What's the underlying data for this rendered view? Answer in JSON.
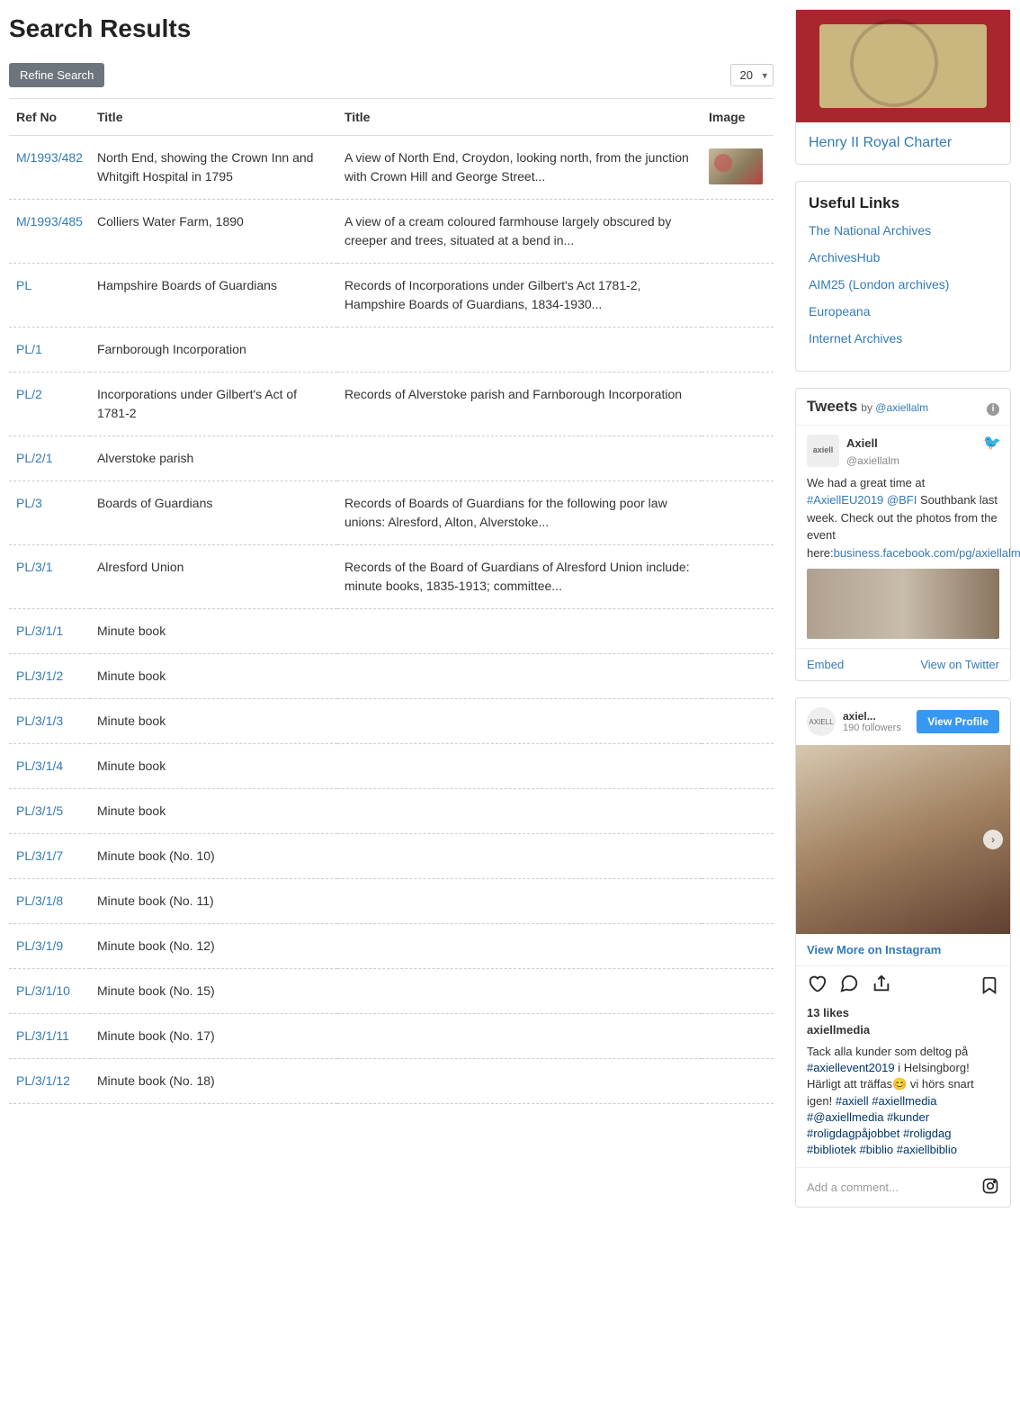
{
  "page_title": "Search Results",
  "refine_label": "Refine Search",
  "page_size": "20",
  "columns": [
    "Ref No",
    "Title",
    "Title",
    "Image"
  ],
  "rows": [
    {
      "ref": "M/1993/482",
      "t1": "North End, showing the Crown Inn and Whitgift Hospital in 1795",
      "t2": "A view of North End, Croydon, looking north, from the junction with Crown Hill and George Street...",
      "img": true
    },
    {
      "ref": "M/1993/485",
      "t1": "Colliers Water Farm, 1890",
      "t2": "A view of a cream coloured farmhouse largely obscured by creeper and trees, situated at a bend in...",
      "img": false
    },
    {
      "ref": "PL",
      "t1": "Hampshire Boards of Guardians",
      "t2": "Records of Incorporations under Gilbert's Act 1781-2, Hampshire Boards of Guardians, 1834-1930...",
      "img": false
    },
    {
      "ref": "PL/1",
      "t1": "Farnborough Incorporation",
      "t2": "",
      "img": false
    },
    {
      "ref": "PL/2",
      "t1": "Incorporations under Gilbert's Act of 1781-2",
      "t2": "Records of Alverstoke parish and Farnborough Incorporation",
      "img": false
    },
    {
      "ref": "PL/2/1",
      "t1": "Alverstoke parish",
      "t2": "",
      "img": false
    },
    {
      "ref": "PL/3",
      "t1": "Boards of Guardians",
      "t2": "Records of Boards of Guardians for the following poor law unions: Alresford, Alton, Alverstoke...",
      "img": false
    },
    {
      "ref": "PL/3/1",
      "t1": "Alresford Union",
      "t2": "Records of the Board of Guardians of Alresford Union include: minute books, 1835-1913; committee...",
      "img": false
    },
    {
      "ref": "PL/3/1/1",
      "t1": "Minute book",
      "t2": "",
      "img": false
    },
    {
      "ref": "PL/3/1/2",
      "t1": "Minute book",
      "t2": "",
      "img": false
    },
    {
      "ref": "PL/3/1/3",
      "t1": "Minute book",
      "t2": "",
      "img": false
    },
    {
      "ref": "PL/3/1/4",
      "t1": "Minute book",
      "t2": "",
      "img": false
    },
    {
      "ref": "PL/3/1/5",
      "t1": "Minute book",
      "t2": "",
      "img": false
    },
    {
      "ref": "PL/3/1/7",
      "t1": "Minute book (No. 10)",
      "t2": "",
      "img": false
    },
    {
      "ref": "PL/3/1/8",
      "t1": "Minute book (No. 11)",
      "t2": "",
      "img": false
    },
    {
      "ref": "PL/3/1/9",
      "t1": "Minute book (No. 12)",
      "t2": "",
      "img": false
    },
    {
      "ref": "PL/3/1/10",
      "t1": "Minute book (No. 15)",
      "t2": "",
      "img": false
    },
    {
      "ref": "PL/3/1/11",
      "t1": "Minute book (No. 17)",
      "t2": "",
      "img": false
    },
    {
      "ref": "PL/3/1/12",
      "t1": "Minute book (No. 18)",
      "t2": "",
      "img": false
    }
  ],
  "charter_link": "Henry II Royal Charter",
  "useful_links_title": "Useful Links",
  "useful_links": [
    "The National Archives",
    "ArchivesHub",
    "AIM25 (London archives)",
    "Europeana",
    "Internet Archives"
  ],
  "tweets": {
    "title": "Tweets",
    "by_prefix": "by ",
    "by_handle": "@axiellalm",
    "avatar": "axiell",
    "name": "Axiell",
    "handle": "@axiellalm",
    "text1": "We had a great time at ",
    "hash1": "#AxiellEU2019",
    "hash2": "@BFI",
    "text2": " Southbank last week. Check out the photos from the event here:",
    "link": "business.facebook.com/pg/axiellalm/p…",
    "embed": "Embed",
    "view": "View on Twitter"
  },
  "ig": {
    "avatar": "AXIELL",
    "name": "axiel...",
    "followers": "190 followers",
    "view_profile": "View Profile",
    "view_more": "View More on Instagram",
    "likes": "13 likes",
    "user": "axiellmedia",
    "caption_pre": "Tack alla kunder som deltog på ",
    "tag1": "#axiellevent2019",
    "caption_mid": " i Helsingborg! Härligt att träffas😊 vi hörs snart igen! ",
    "tags": "#axiell #axiellmedia #@axiellmedia #kunder #roligdagpåjobbet #roligdag #bibliotek #biblio #axiellbiblio",
    "add_comment": "Add a comment..."
  }
}
